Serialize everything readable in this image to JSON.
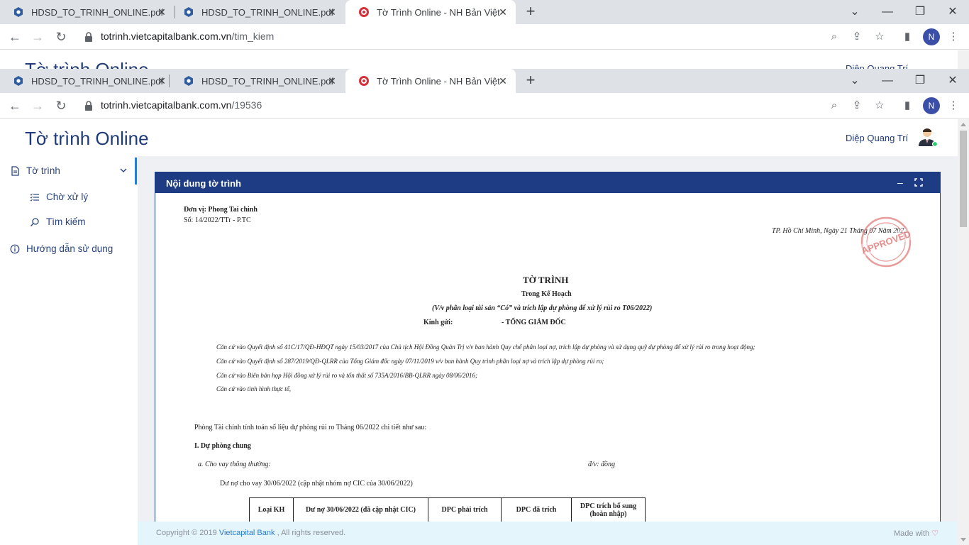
{
  "browser": {
    "tabs": [
      {
        "title": "HDSD_TO_TRINH_ONLINE.pdf"
      },
      {
        "title": "HDSD_TO_TRINH_ONLINE.pdf"
      },
      {
        "title": "Tờ Trình Online - NH Bản Việt"
      }
    ],
    "bg_url_domain": "totrinh.vietcapitalbank.com.vn",
    "bg_url_path": "/tim_kiem",
    "url_domain": "totrinh.vietcapitalbank.com.vn",
    "url_path": "/19536",
    "profile_initial": "N"
  },
  "app": {
    "title": "Tờ trình Online",
    "user_name": "Diệp Quang Trí"
  },
  "sidebar": {
    "items": [
      {
        "label": "Tờ trình"
      },
      {
        "label": "Chờ xử lý"
      },
      {
        "label": "Tìm kiếm"
      },
      {
        "label": "Hướng dẫn sử dụng"
      }
    ]
  },
  "panel": {
    "title": "Nội dung tờ trình"
  },
  "doc": {
    "unit": "Đơn vị: Phong Tai chinh",
    "number": "Số: 14/2022/TTr - P.TC",
    "place_date": "TP. Hồ Chí Minh, Ngày 21 Tháng 07 Năm 2022",
    "heading": "TỜ TRÌNH",
    "plan": "Trong Kế Hoạch",
    "subject": "(V/v phân loại tài sản “Có” và trích lập dự phòng để xử lý rủi ro T06/2022)",
    "to_label": "Kính gửi:",
    "to_value": "- TỔNG GIÁM ĐỐC",
    "bases": [
      "Căn cứ vào Quyết định số 41C/17/QĐ-HĐQT ngày 15/03/2017 của Chủ tịch Hội Đồng Quản Trị v/v ban hành Quy chế phân loại nợ, trích lập dự phòng và sử dụng quỹ dự phòng để xử lý rủi ro trong hoạt động;",
      "Căn cứ vào Quyết định số 287/2019/QĐ-QLRR của Tổng Giám đốc ngày 07/11/2019 v/v ban hành Quy trình phân loại nợ và trích lập dự phòng rủi ro;",
      "Căn cứ vào Biên bản họp Hội đồng xử lý rủi ro và tổn thất số 735A/2016/BB-QLRR ngày 08/06/2016;",
      "Căn cứ vào tình hình thực tế,"
    ],
    "intro": "Phòng Tài chính tính toán số liệu dự phòng rủi ro Tháng 06/2022 chi tiết như sau:",
    "section1": "I.  Dự phòng chung",
    "sub_a": "a.  Cho vay thông thường:",
    "unit_note": "đ/v: đồng",
    "debt_line": "Dư nợ cho vay 30/06/2022 (cập nhật nhóm nợ CIC của 30/06/2022)",
    "table_headers": [
      "Loại KH",
      "Dư nợ 30/06/2022 (đã cập nhật CIC)",
      "DPC phải trích",
      "DPC đã trích",
      "DPC trích bổ sung (hoàn nhập)"
    ],
    "stamp_text": "APPROVED"
  },
  "footer": {
    "copy_prefix": "Copyright © 2019 ",
    "brand": "Vietcapital Bank",
    "copy_suffix": " , All rights reserved.",
    "made_with": "Made with "
  }
}
